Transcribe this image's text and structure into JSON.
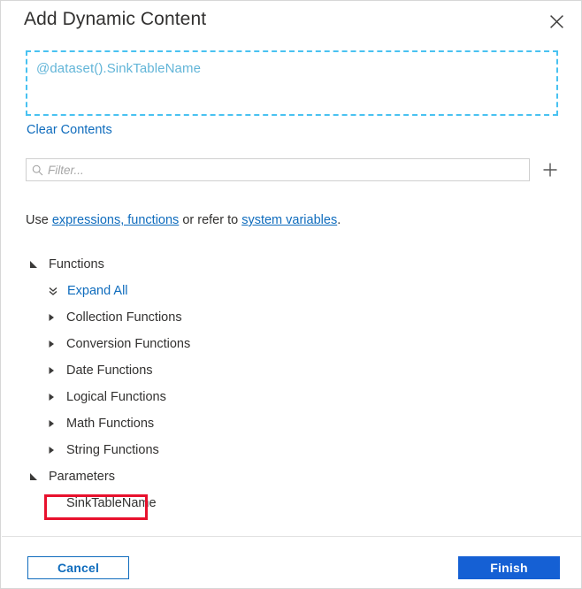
{
  "dialog": {
    "title": "Add Dynamic Content",
    "close_icon": "close-icon"
  },
  "expression": {
    "value": "@dataset().SinkTableName",
    "clear_label": "Clear Contents"
  },
  "filter": {
    "placeholder": "Filter...",
    "value": "",
    "search_icon": "search-icon",
    "add_icon": "plus-icon"
  },
  "hint": {
    "prefix": "Use ",
    "link1": "expressions, functions",
    "middle": " or refer to ",
    "link2": "system variables",
    "suffix": "."
  },
  "tree": {
    "functions_group": {
      "label": "Functions",
      "expanded": true,
      "expand_all_label": "Expand All",
      "expand_all_icon": "double-chevron-down-icon"
    },
    "function_categories": [
      {
        "label": "Collection Functions",
        "expanded": false
      },
      {
        "label": "Conversion Functions",
        "expanded": false
      },
      {
        "label": "Date Functions",
        "expanded": false
      },
      {
        "label": "Logical Functions",
        "expanded": false
      },
      {
        "label": "Math Functions",
        "expanded": false
      },
      {
        "label": "String Functions",
        "expanded": false
      }
    ],
    "parameters_group": {
      "label": "Parameters",
      "expanded": true
    },
    "parameters": [
      {
        "label": "SinkTableName",
        "highlighted": true
      }
    ]
  },
  "footer": {
    "cancel_label": "Cancel",
    "finish_label": "Finish"
  },
  "colors": {
    "accent_blue": "#0f6cbd",
    "primary_button": "#1560d4",
    "expression_border": "#49c2f1",
    "expression_text": "#62b5d8",
    "highlight_red": "#e8112d",
    "text_primary": "#323130"
  }
}
